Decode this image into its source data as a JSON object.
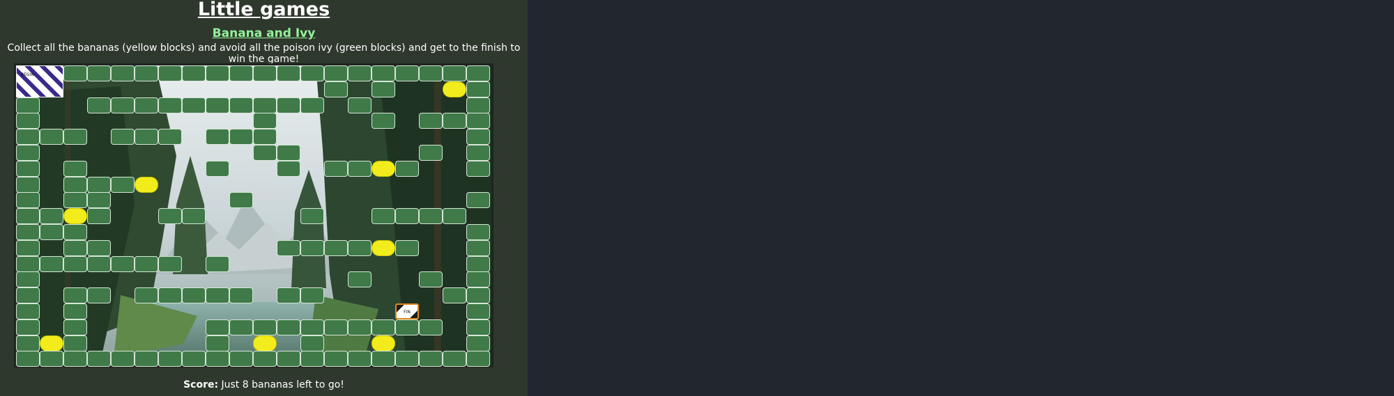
{
  "header": {
    "page_title": "Little games",
    "game_title": "Banana and Ivy",
    "instructions": "Collect all the bananas (yellow blocks) and avoid all the poison ivy (green blocks) and get to the finish to win the game!"
  },
  "board": {
    "background": "forest-lake-scene",
    "cols": 20,
    "rows": 19,
    "legend": {
      "#": "poison-ivy",
      "Y": "banana",
      "B": "begin",
      "F": "finish",
      ".": "empty"
    },
    "grid": [
      "BB##################",
      "BB...........#.#..Y#",
      "#..##########.#....#",
      "#.........#....#.###",
      "###.###.###........#",
      "#.........##.....#.#",
      "#.#.....#..#.##Y#..#",
      "#.###Y..............",
      "#.##.....#.........#",
      "##Y#..##....#..####.",
      "###................#",
      "#.##.......####Y#..#",
      "#######.#..........#",
      "#.............#..#.#",
      "#.##.#####.##.....##",
      "#.#.............F..#",
      "#.#.....##########.#",
      "#Y#.....#.Y.#..Y...#",
      "####################"
    ],
    "begin_label": "BEGIN",
    "finish_label": "FIN",
    "colors": {
      "ivy": "#3f7a48",
      "banana": "#f2ec1d",
      "panel": "#2f382d",
      "page": "#22262f"
    }
  },
  "score": {
    "label": "Score:",
    "text": " Just 8 bananas left to go!"
  }
}
